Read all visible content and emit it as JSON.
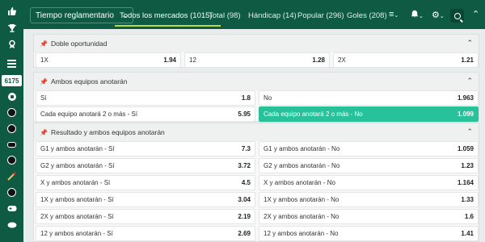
{
  "rail": {
    "count": "6175",
    "icons": [
      "thumbs-up-icon",
      "trophy-icon",
      "award-icon",
      "menu-icon",
      "football-icon",
      "basketball-icon",
      "volleyball-icon",
      "hockey-icon",
      "table-tennis-icon",
      "cricket-icon",
      "handball-icon",
      "esports-icon",
      "rugby-icon"
    ]
  },
  "topbar": {
    "period": "Tiempo reglamentario",
    "tabs": [
      {
        "label": "Todos los mercados (1015)"
      },
      {
        "label": "Total (98)"
      },
      {
        "label": "Hándicap (14)"
      },
      {
        "label": "Popular (296)"
      },
      {
        "label": "Goles (208)"
      }
    ]
  },
  "panels": [
    {
      "title": "Doble oportunidad",
      "rows": [
        [
          {
            "label": "1X",
            "odd": "1.94"
          },
          {
            "label": "12",
            "odd": "1.28"
          },
          {
            "label": "2X",
            "odd": "1.21"
          }
        ]
      ]
    },
    {
      "title": "Ambos equipos anotarán",
      "rows": [
        [
          {
            "label": "Sí",
            "odd": "1.8"
          },
          {
            "label": "No",
            "odd": "1.963"
          }
        ],
        [
          {
            "label": "Cada equipo anotará 2 o más - Sí",
            "odd": "5.95"
          },
          {
            "label": "Cada equipo anotará 2 o más - No",
            "odd": "1.099"
          }
        ]
      ]
    },
    {
      "title": "Resultado y ambos equipos anotarán",
      "rows": [
        [
          {
            "label": "G1 y ambos anotarán - Sí",
            "odd": "7.3"
          },
          {
            "label": "G1 y ambos anotarán - No",
            "odd": "1.059"
          }
        ],
        [
          {
            "label": "G2 y ambos anotarán - Sí",
            "odd": "3.72"
          },
          {
            "label": "G2 y ambos anotarán - No",
            "odd": "1.23"
          }
        ],
        [
          {
            "label": "X y ambos anotarán - Sí",
            "odd": "4.5"
          },
          {
            "label": "X y ambos anotarán - No",
            "odd": "1.164"
          }
        ],
        [
          {
            "label": "1X y ambos anotarán - Sí",
            "odd": "3.04"
          },
          {
            "label": "1X y ambos anotarán - No",
            "odd": "1.33"
          }
        ],
        [
          {
            "label": "2X y ambos anotarán - Sí",
            "odd": "2.19"
          },
          {
            "label": "2X y ambos anotarán - No",
            "odd": "1.6"
          }
        ],
        [
          {
            "label": "12 y ambos anotarán - Sí",
            "odd": "2.69"
          },
          {
            "label": "12 y ambos anotarán - No",
            "odd": "1.41"
          }
        ]
      ]
    }
  ],
  "colors": {
    "brand": "#0f5a43",
    "accent": "#b9d94b",
    "selected": "#27c29a"
  }
}
